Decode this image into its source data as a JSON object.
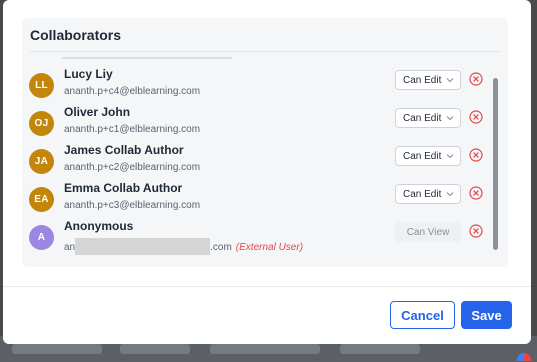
{
  "dialog": {
    "panel_title": "Collaborators",
    "collaborators": [
      {
        "initials": "LL",
        "name": "Lucy Liy",
        "email": "ananth.p+c4@elblearning.com",
        "permission": "Can Edit",
        "avatar_color": "#c2860a"
      },
      {
        "initials": "OJ",
        "name": "Oliver John",
        "email": "ananth.p+c1@elblearning.com",
        "permission": "Can Edit",
        "avatar_color": "#c2860a"
      },
      {
        "initials": "JA",
        "name": "James Collab Author",
        "email": "ananth.p+c2@elblearning.com",
        "permission": "Can Edit",
        "avatar_color": "#c2860a"
      },
      {
        "initials": "EA",
        "name": "Emma Collab Author",
        "email": "ananth.p+c3@elblearning.com",
        "permission": "Can Edit",
        "avatar_color": "#c2860a"
      },
      {
        "initials": "A",
        "name": "Anonymous",
        "email_prefix": "an",
        "email_suffix": ".com",
        "external_tag": "(External User)",
        "permission": "Can View",
        "avatar_color": "#9c87e0"
      }
    ],
    "buttons": {
      "cancel": "Cancel",
      "save": "Save"
    }
  },
  "colors": {
    "accent": "#2563eb",
    "remove_icon": "#e24a4a",
    "external_tag": "#e24a4a"
  },
  "icons": {
    "permission_dropdown": "chevron-down-icon",
    "remove_collaborator": "remove-circle-x-icon"
  }
}
